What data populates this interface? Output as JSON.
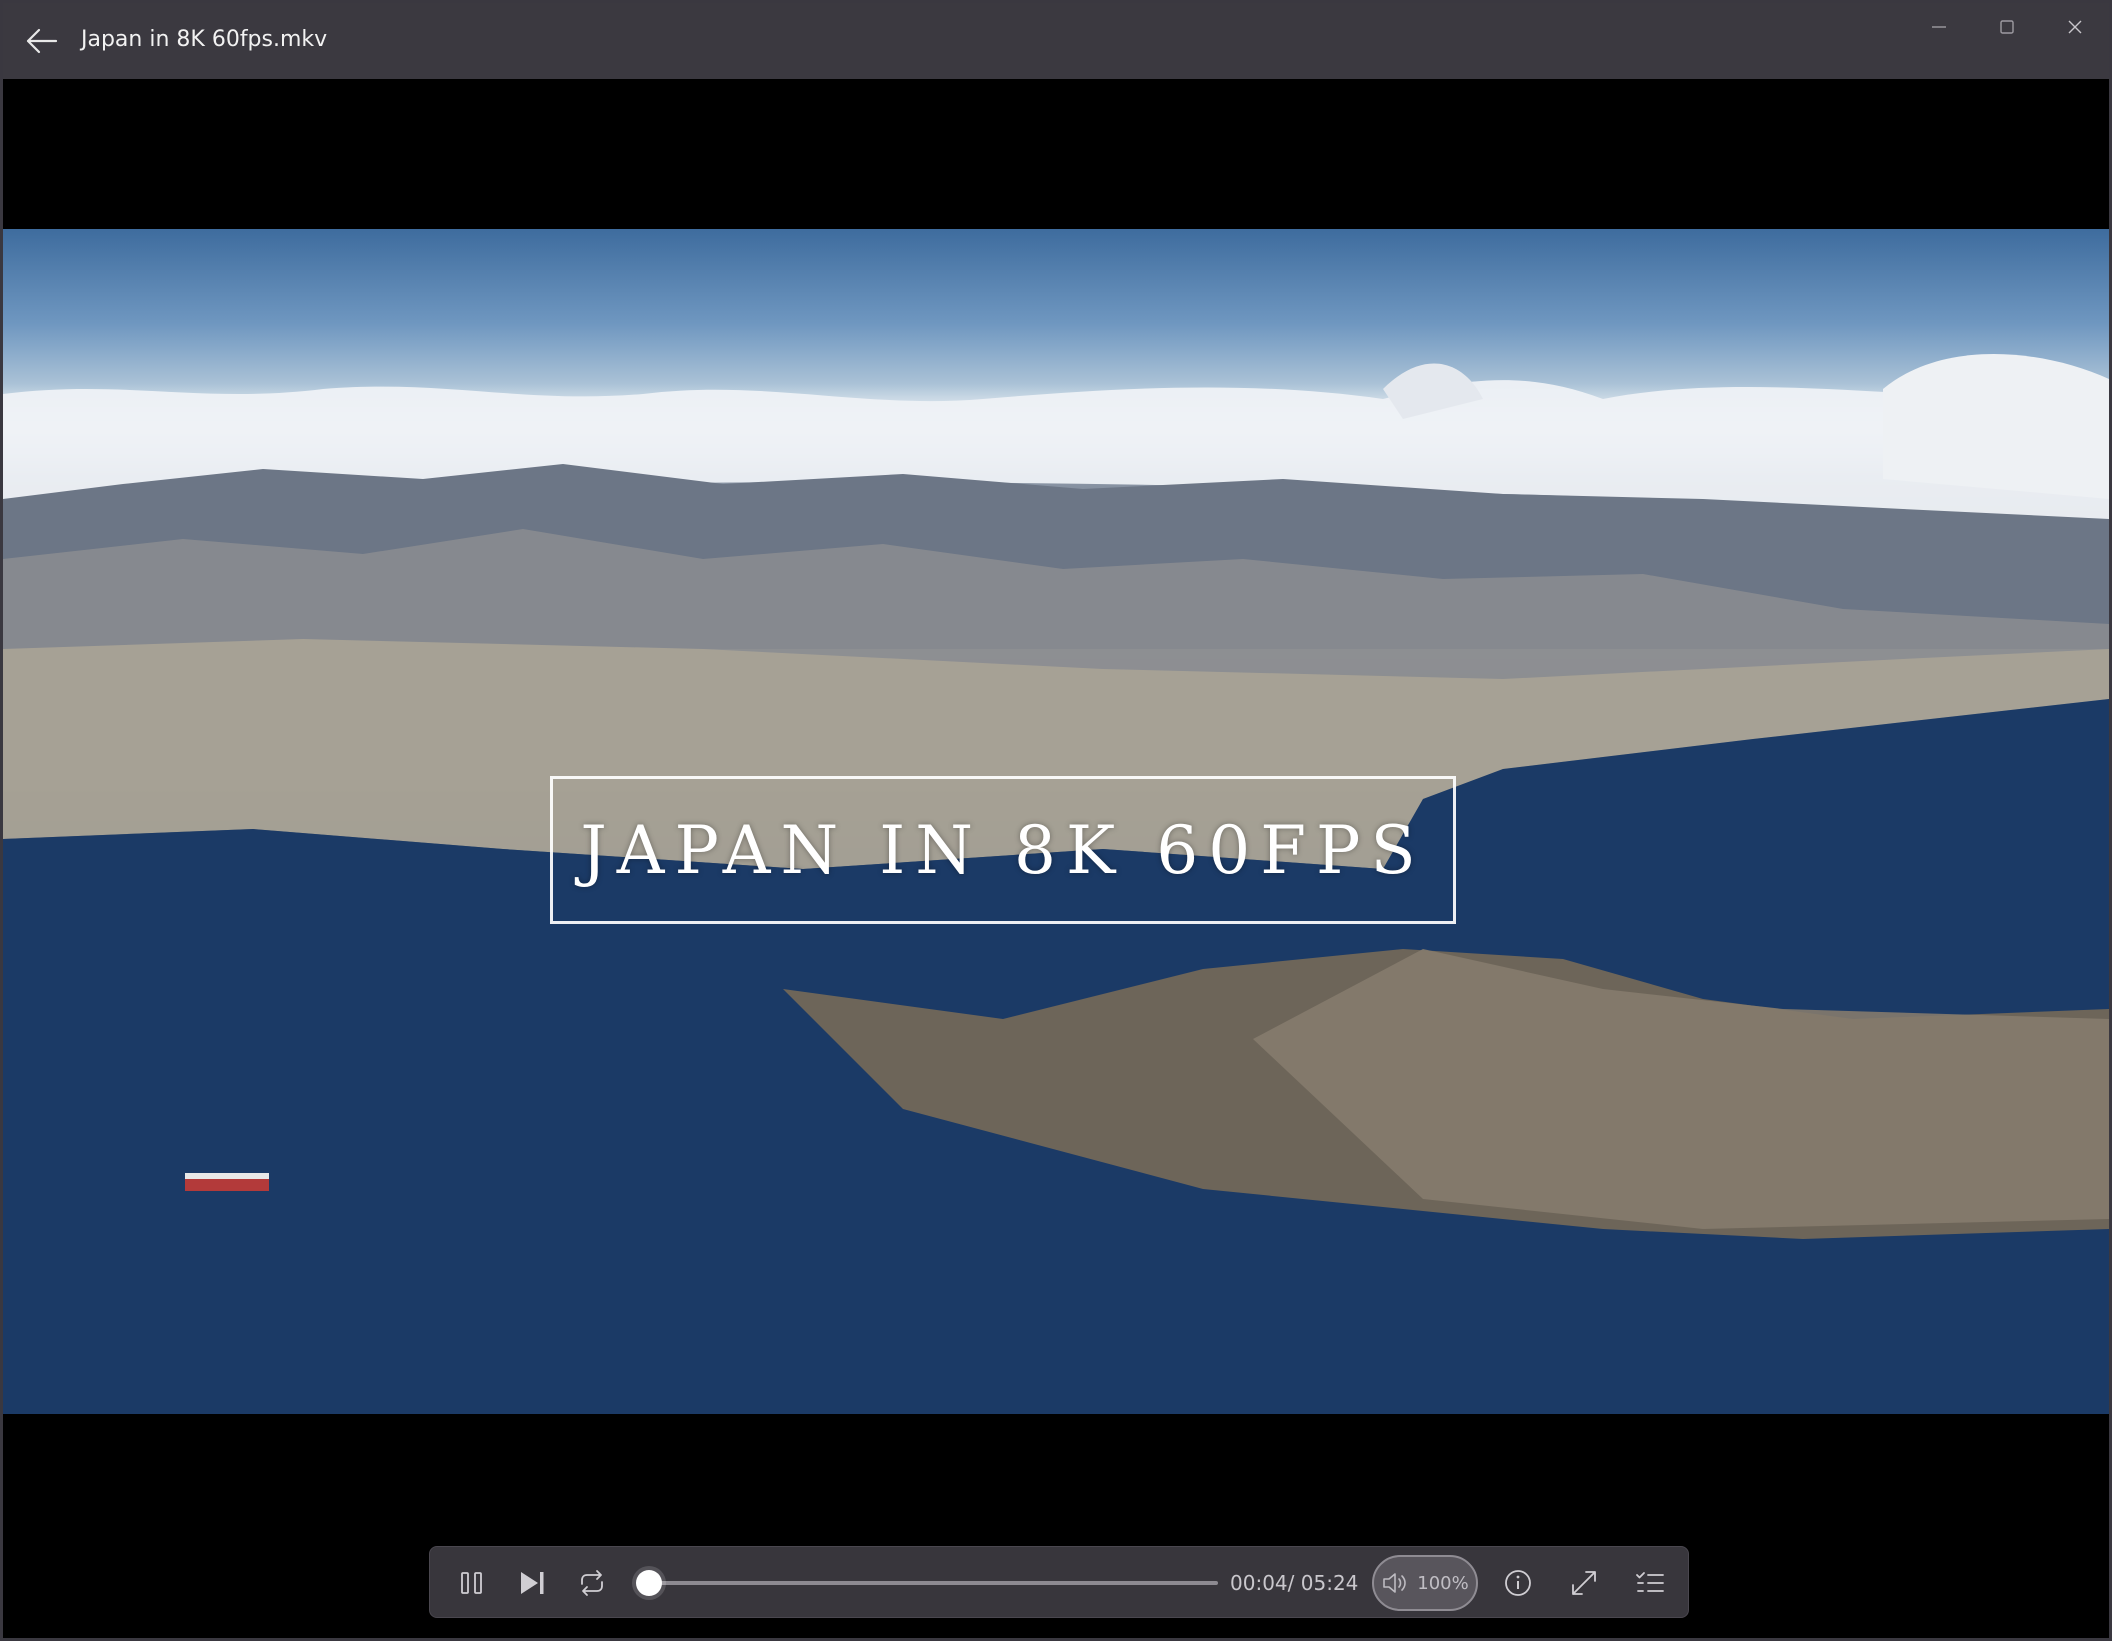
{
  "window": {
    "title": "Japan in 8K 60fps.mkv"
  },
  "video": {
    "overlay_text": "Japan in 8K 60fps"
  },
  "controls": {
    "current_time": "00:04",
    "separator": "/ ",
    "total_time": "05:24",
    "progress_percent": 1.2,
    "volume_label": "100%"
  },
  "icons": {
    "back": "arrow-left-icon",
    "minimize": "minimize-icon",
    "maximize": "maximize-icon",
    "close": "close-icon",
    "pause": "pause-icon",
    "next": "skip-next-icon",
    "repeat": "repeat-icon",
    "volume": "speaker-icon",
    "info": "info-icon",
    "fullscreen": "fullscreen-icon",
    "playlist": "playlist-icon"
  },
  "colors": {
    "titlebar": "#3b3940",
    "controls_bg": "#38363c",
    "accent": "#ffffff"
  }
}
